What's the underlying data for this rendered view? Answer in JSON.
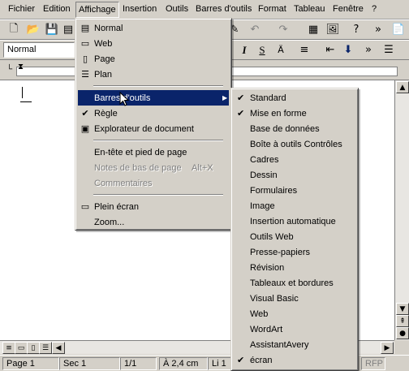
{
  "menubar": {
    "items": [
      "Fichier",
      "Edition",
      "Affichage",
      "Insertion",
      "Outils",
      "Barres d'outils",
      "Format",
      "Tableau",
      "Fenêtre",
      "?"
    ]
  },
  "toolbar": {
    "style_value": "Normal"
  },
  "affichage_menu": {
    "items": [
      {
        "label": "Normal",
        "icon": "normal-view-icon"
      },
      {
        "label": "Web",
        "icon": "web-view-icon"
      },
      {
        "label": "Page",
        "icon": "page-view-icon"
      },
      {
        "label": "Plan",
        "icon": "outline-view-icon"
      },
      {
        "label": "Barres d'outils",
        "highlighted": true
      },
      {
        "label": "Règle",
        "checked": true
      },
      {
        "label": "Explorateur de document",
        "icon": "document-map-icon"
      },
      {
        "label": "En-tête et pied de page"
      },
      {
        "label": "Notes de bas de page",
        "shortcut": "Alt+X",
        "disabled": true
      },
      {
        "label": "Commentaires",
        "disabled": true
      },
      {
        "label": "Plein écran",
        "icon": "full-screen-icon"
      },
      {
        "label": "Zoom..."
      }
    ]
  },
  "toolbars_submenu": {
    "items": [
      {
        "label": "Standard",
        "checked": true
      },
      {
        "label": "Mise en forme",
        "checked": true
      },
      {
        "label": "Base de données"
      },
      {
        "label": "Boîte à outils Contrôles"
      },
      {
        "label": "Cadres"
      },
      {
        "label": "Dessin"
      },
      {
        "label": "Formulaires"
      },
      {
        "label": "Image"
      },
      {
        "label": "Insertion automatique"
      },
      {
        "label": "Outils Web"
      },
      {
        "label": "Presse-papiers"
      },
      {
        "label": "Révision"
      },
      {
        "label": "Tableaux et bordures"
      },
      {
        "label": "Visual Basic"
      },
      {
        "label": "Web"
      },
      {
        "label": "WordArt"
      },
      {
        "label": "AssistantAvery"
      },
      {
        "label": "écran",
        "checked": true
      }
    ]
  },
  "statusbar": {
    "page": "Page 1",
    "section": "Sec 1",
    "pages": "1/1",
    "position": "À 2,4 cm",
    "line": "Li 1",
    "rfp": "RFP"
  }
}
